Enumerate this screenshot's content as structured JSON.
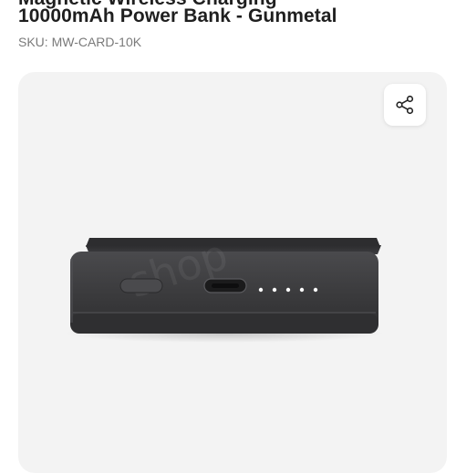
{
  "product": {
    "title_partial": "Magnetic Wireless Charging",
    "title": "10000mAh Power Bank - Gunmetal",
    "sku": "SKU: MW-CARD-10K"
  },
  "gallery": {
    "share_icon": "share-icon",
    "image": "power-bank-front-view"
  },
  "colors": {
    "gallery_bg": "#f3f3f3",
    "product_body": "#3b3b3d",
    "indicator_led": "#ffffff"
  }
}
